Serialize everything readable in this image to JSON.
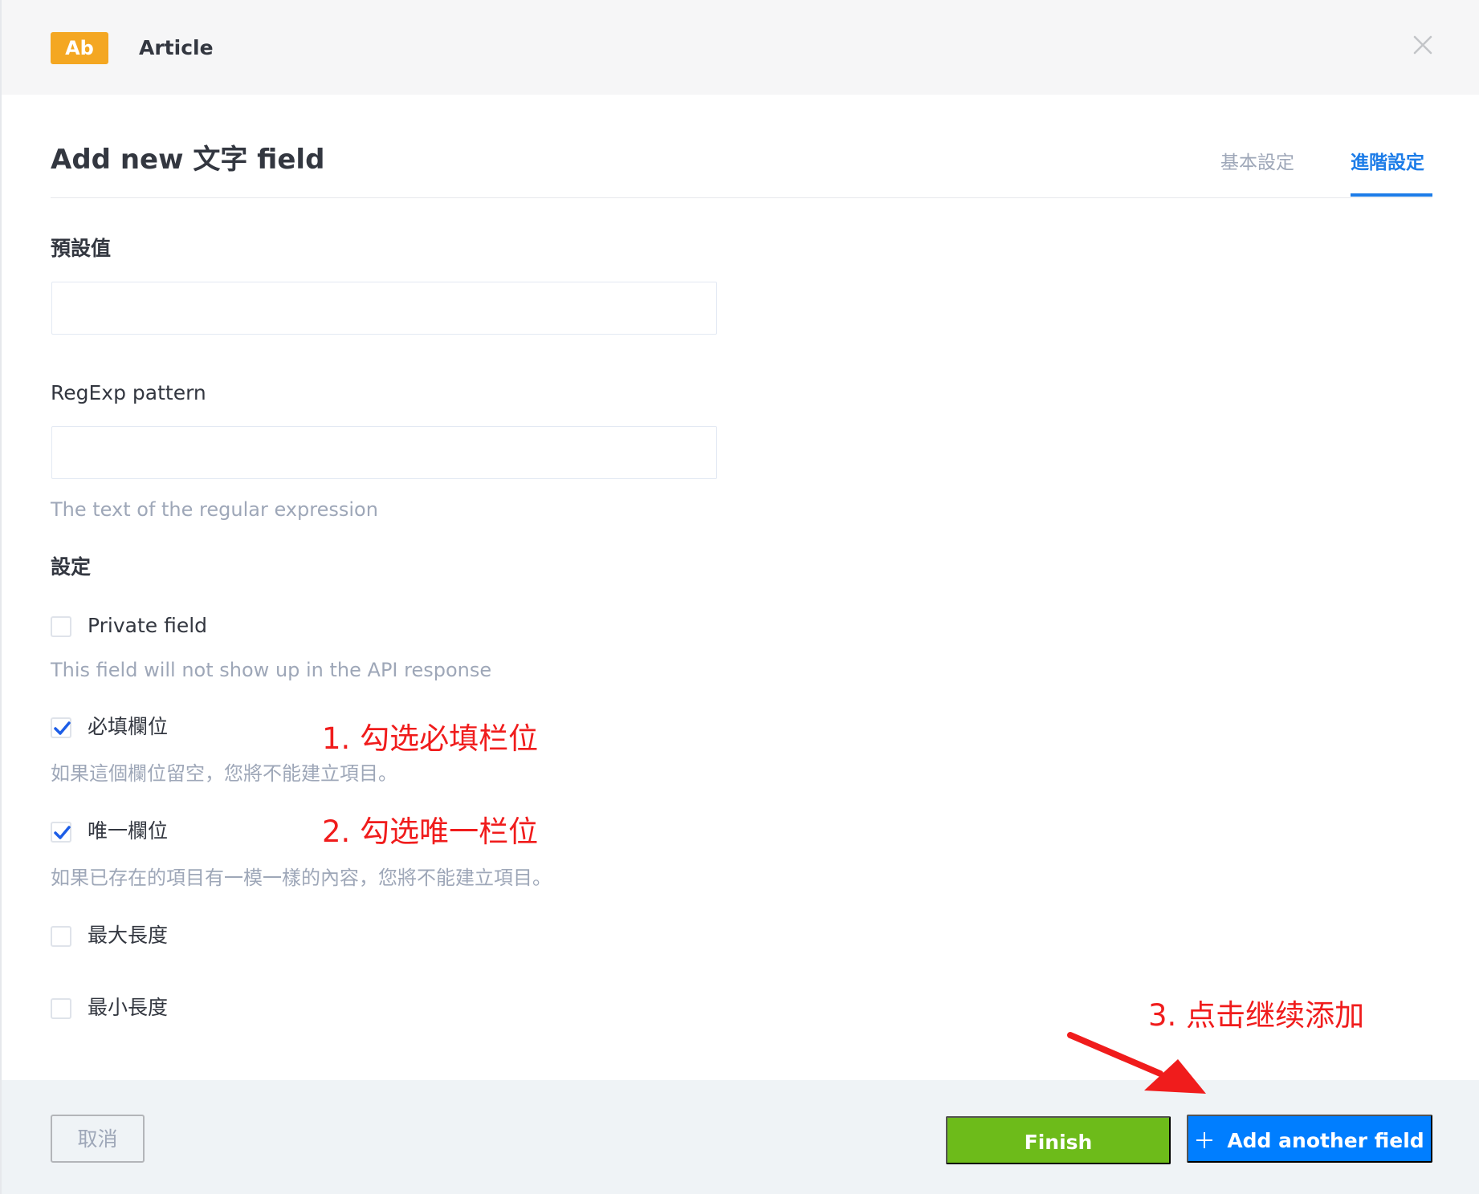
{
  "header": {
    "badge": "Ab",
    "content_type": "Article",
    "close_icon": "close-icon"
  },
  "modal": {
    "title": "Add new 文字 field",
    "tabs": [
      {
        "label": "基本設定",
        "active": false
      },
      {
        "label": "進階設定",
        "active": true
      }
    ]
  },
  "form": {
    "default_value": {
      "label": "預設值",
      "value": "",
      "placeholder": ""
    },
    "regexp": {
      "label": "RegExp pattern",
      "value": "",
      "placeholder": "",
      "hint": "The text of the regular expression"
    },
    "settings_label": "設定",
    "options": [
      {
        "label": "Private field",
        "checked": false,
        "hint": "This field will not show up in the API response"
      },
      {
        "label": "必填欄位",
        "checked": true,
        "hint": "如果這個欄位留空，您將不能建立項目。"
      },
      {
        "label": "唯一欄位",
        "checked": true,
        "hint": "如果已存在的項目有一模一樣的內容，您將不能建立項目。"
      },
      {
        "label": "最大長度",
        "checked": false
      },
      {
        "label": "最小長度",
        "checked": false
      }
    ]
  },
  "annotations": {
    "step1": "1. 勾选必填栏位",
    "step2": "2. 勾选唯一栏位",
    "step3": "3. 点击继续添加"
  },
  "footer": {
    "cancel_label": "取消",
    "finish_label": "Finish",
    "add_another_label": "Add another field"
  },
  "colors": {
    "accent_blue": "#007eff",
    "tab_active": "#1c7ce8",
    "finish_green": "#6dbb1a",
    "badge_orange": "#f4a722",
    "annotation_red": "#f01c1c"
  }
}
